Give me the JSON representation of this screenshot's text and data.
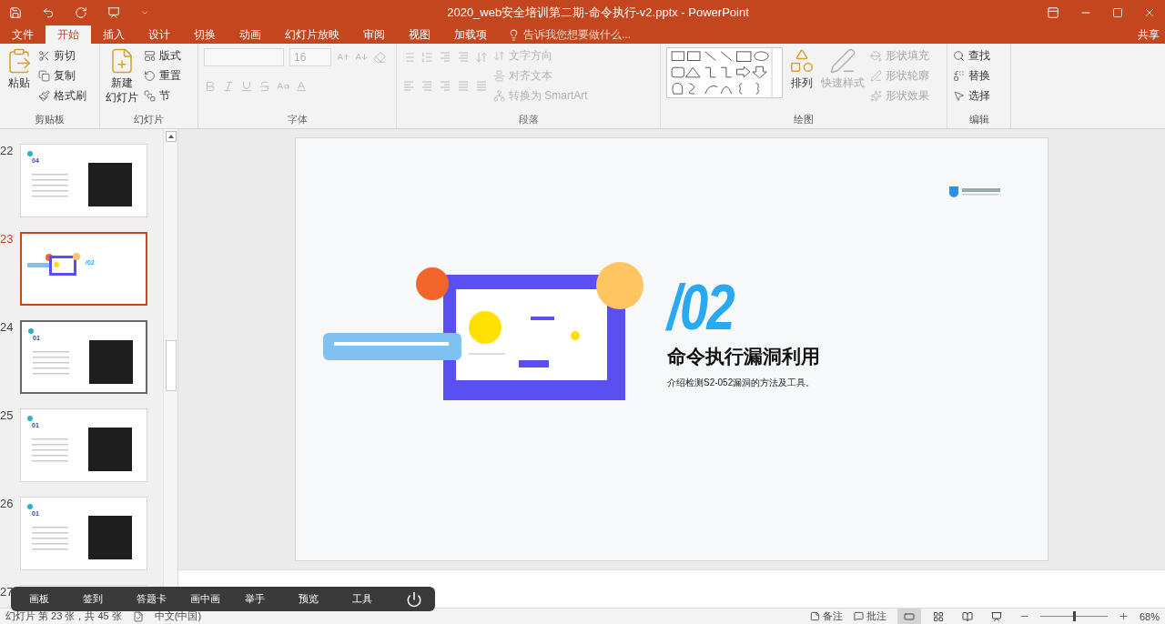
{
  "window": {
    "title": "2020_web安全培训第二期-命令执行-v2.pptx - PowerPoint"
  },
  "menu_tabs": [
    {
      "label": "文件",
      "selected": false
    },
    {
      "label": "开始",
      "selected": true
    },
    {
      "label": "插入",
      "selected": false
    },
    {
      "label": "设计",
      "selected": false
    },
    {
      "label": "切换",
      "selected": false
    },
    {
      "label": "动画",
      "selected": false
    },
    {
      "label": "幻灯片放映",
      "selected": false
    },
    {
      "label": "审阅",
      "selected": false
    },
    {
      "label": "视图",
      "selected": false
    },
    {
      "label": "加载项",
      "selected": false
    }
  ],
  "tell_me": {
    "placeholder": "告诉我您想要做什么..."
  },
  "share": "共享",
  "ribbon": [
    {
      "kind": "clipboard",
      "label": "剪贴板",
      "disabled": false,
      "large": [
        {
          "lines": [
            "粘贴"
          ],
          "disabled": false
        }
      ],
      "small": [
        {
          "label": "剪切",
          "disabled": false
        },
        {
          "label": "复制",
          "disabled": false
        },
        {
          "label": "格式刷",
          "disabled": false
        }
      ]
    },
    {
      "kind": "slides",
      "label": "幻灯片",
      "disabled": false,
      "large": [
        {
          "lines": [
            "新建",
            "幻灯片"
          ],
          "disabled": false
        }
      ],
      "small": [
        {
          "label": "版式",
          "disabled": false
        },
        {
          "label": "重置",
          "disabled": false
        },
        {
          "label": "节",
          "disabled": false
        }
      ]
    },
    {
      "kind": "font",
      "label": "字体",
      "disabled": true,
      "font_size": "16"
    },
    {
      "kind": "paragraph",
      "label": "段落",
      "disabled": true,
      "small": [
        {
          "label": "文字方向",
          "disabled": true
        },
        {
          "label": "对齐文本",
          "disabled": true
        },
        {
          "label": "转换为 SmartArt",
          "disabled": true
        }
      ]
    },
    {
      "kind": "drawing",
      "label": "绘图",
      "disabled": false,
      "large": [
        {
          "lines": [
            "排列"
          ],
          "disabled": false
        },
        {
          "lines": [
            "快速样式"
          ],
          "disabled": true
        }
      ],
      "small": [
        {
          "label": "形状填充",
          "disabled": true
        },
        {
          "label": "形状轮廓",
          "disabled": true
        },
        {
          "label": "形状效果",
          "disabled": true
        }
      ]
    },
    {
      "kind": "editing",
      "label": "编辑",
      "disabled": false,
      "small": [
        {
          "label": "查找",
          "disabled": false
        },
        {
          "label": "替换",
          "disabled": false
        },
        {
          "label": "选择",
          "disabled": false
        }
      ]
    }
  ],
  "thumbnails": [
    {
      "number": "22",
      "selected": false,
      "hovered": false,
      "kind": "code",
      "heading": "04"
    },
    {
      "number": "23",
      "selected": true,
      "hovered": false,
      "kind": "section",
      "heading": "/02"
    },
    {
      "number": "24",
      "selected": false,
      "hovered": true,
      "kind": "code",
      "heading": "01"
    },
    {
      "number": "25",
      "selected": false,
      "hovered": false,
      "kind": "code",
      "heading": "01"
    },
    {
      "number": "26",
      "selected": false,
      "hovered": false,
      "kind": "code",
      "heading": "01"
    },
    {
      "number": "27",
      "selected": false,
      "hovered": false,
      "kind": "blank"
    }
  ],
  "slide": {
    "number": "/02",
    "title": "命令执行漏洞利用",
    "subtitle": "介绍检测S2-052漏洞的方法及工具。"
  },
  "floating_toolbar": {
    "items": [
      "画板",
      "签到",
      "答题卡",
      "画中画",
      "举手",
      "预览",
      "工具"
    ]
  },
  "status_bar": {
    "slide_info": "幻灯片 第 23 张，共 45 张",
    "language": "中文(中国)",
    "notes": "备注",
    "comments": "批注",
    "views": [
      {
        "kind": "normal",
        "selected": true
      },
      {
        "kind": "sorter",
        "selected": false
      },
      {
        "kind": "reading",
        "selected": false
      },
      {
        "kind": "show",
        "selected": false
      }
    ],
    "zoom": {
      "level": 0.5,
      "reading": "68%"
    }
  }
}
